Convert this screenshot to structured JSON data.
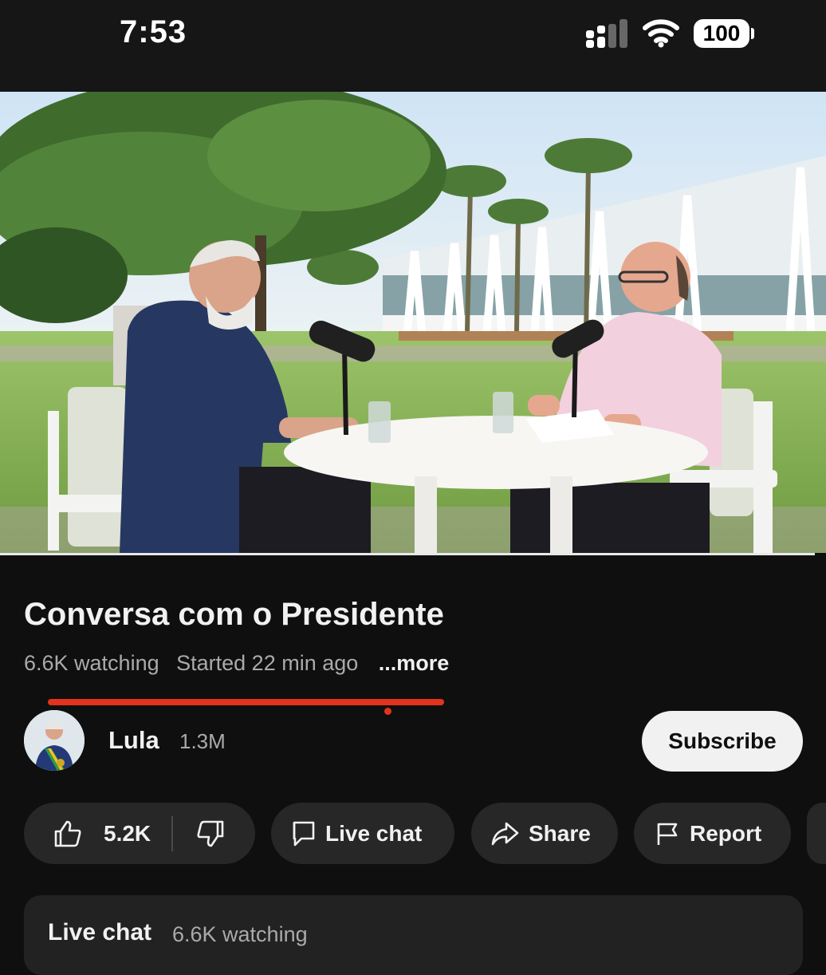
{
  "status_bar": {
    "time": "7:53",
    "battery": "100",
    "icons": [
      "signal-icon",
      "wifi-icon",
      "battery-icon"
    ]
  },
  "video": {
    "scene": "outdoor-interview-thumbnail",
    "progress": 0.9
  },
  "video_info": {
    "title": "Conversa com o Presidente",
    "watching": "6.6K watching",
    "started": "Started 22 min ago",
    "more": "...more"
  },
  "channel": {
    "name": "Lula",
    "subscribers": "1.3M",
    "subscribe_label": "Subscribe"
  },
  "actions": {
    "likes": "5.2K",
    "live_chat": "Live chat",
    "share": "Share",
    "report": "Report"
  },
  "live_chat_panel": {
    "title": "Live chat",
    "watching": "6.6K watching"
  },
  "colors": {
    "background": "#0f0f0f",
    "progress": "#e2331d",
    "pill": "#272727",
    "subscribe_bg": "#f1f1f1"
  }
}
